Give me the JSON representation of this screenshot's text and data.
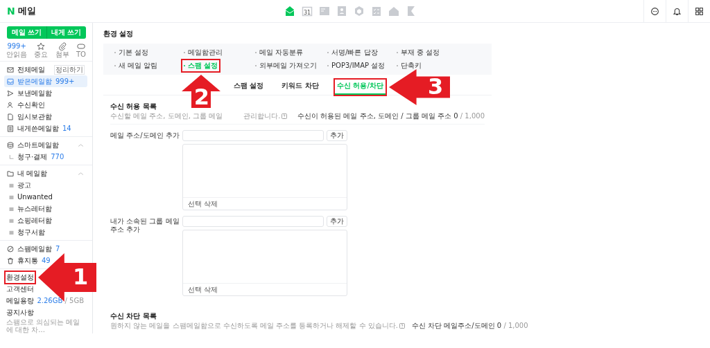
{
  "header": {
    "logo": "N",
    "title": "메일",
    "apps": [
      {
        "kind": "mail",
        "selected": true
      },
      {
        "kind": "calendar",
        "label": "31",
        "selected": false
      },
      {
        "kind": "note",
        "selected": false
      },
      {
        "kind": "contacts",
        "selected": false
      },
      {
        "kind": "cube",
        "selected": false
      },
      {
        "kind": "checklist",
        "selected": false
      },
      {
        "kind": "house",
        "selected": false
      },
      {
        "kind": "bookmark",
        "selected": false
      }
    ],
    "actions": [
      {
        "kind": "chat"
      },
      {
        "kind": "bell"
      },
      {
        "kind": "grid"
      }
    ]
  },
  "sidebar": {
    "compose_buttons": [
      "메일 쓰기",
      "내게 쓰기"
    ],
    "quick_filters": [
      {
        "kind": "count",
        "value": "999+",
        "label": "안읽음"
      },
      {
        "kind": "star",
        "label": "중요"
      },
      {
        "kind": "clip",
        "label": "첨부"
      },
      {
        "kind": "to",
        "label": "TO"
      }
    ],
    "mailboxes": [
      {
        "label": "전체메일",
        "action": "정리하기",
        "selected": false
      },
      {
        "label": "받은메일함",
        "count": "999+",
        "selected": true
      },
      {
        "label": "보낸메일함",
        "selected": false
      },
      {
        "label": "수신확인",
        "selected": false
      },
      {
        "label": "임시보관함",
        "selected": false
      },
      {
        "label": "내게쓴메일함",
        "count": "14",
        "selected": false
      }
    ],
    "groups": [
      {
        "title": "스마트메일함",
        "expanded": true,
        "children": [
          {
            "label": "청구·결제",
            "count": "770"
          }
        ]
      },
      {
        "title": "내 메일함",
        "expanded": true,
        "children": [
          {
            "label": "광고"
          },
          {
            "label": "Unwanted"
          },
          {
            "label": "뉴스레터함"
          },
          {
            "label": "쇼핑레터함"
          },
          {
            "label": "청구서함"
          }
        ]
      }
    ],
    "special": [
      {
        "label": "스팸메일함",
        "count": "7"
      },
      {
        "label": "휴지통",
        "count": "49"
      }
    ],
    "links": [
      {
        "label": "환경설정",
        "highlighted": true
      },
      {
        "label": "고객센터",
        "highlighted": false
      },
      {
        "label": "메일용량",
        "used": "2.26GB",
        "total": "/ 5GB",
        "highlighted": false
      },
      {
        "label": "공지사항",
        "highlighted": false
      }
    ],
    "notice": "스팸으로 의심되는 메일에 대한 차..."
  },
  "main": {
    "title": "환경 설정",
    "menu": [
      {
        "label": "기본 설정",
        "selected": false,
        "highlighted": false
      },
      {
        "label": "메일함관리",
        "selected": false,
        "highlighted": false
      },
      {
        "label": "메일 자동분류",
        "selected": false,
        "highlighted": false
      },
      {
        "label": "서명/빠른 답장",
        "selected": false,
        "highlighted": false
      },
      {
        "label": "부재 중 설정",
        "selected": false,
        "highlighted": false
      },
      {
        "label": "새 메일 알림",
        "selected": false,
        "highlighted": false
      },
      {
        "label": "스팸 설정",
        "selected": true,
        "highlighted": true
      },
      {
        "label": "외부메일 가져오기",
        "selected": false,
        "highlighted": false
      },
      {
        "label": "POP3/IMAP 설정",
        "selected": false,
        "highlighted": false
      },
      {
        "label": "단축키",
        "selected": false,
        "highlighted": false
      }
    ],
    "tabs": [
      {
        "label": "스팸 설정",
        "selected": false,
        "highlighted": false
      },
      {
        "label": "키워드 차단",
        "selected": false,
        "highlighted": false
      },
      {
        "label": "수신 허용/차단",
        "selected": true,
        "highlighted": true
      }
    ],
    "sections": [
      {
        "title": "수신 허용 목록",
        "description": [
          "수신할 메일 주소, 도메인, 그룹 메일",
          "관리합니다."
        ],
        "summary_label": "수신이 허용된 메일 주소, 도메인 / 그룹 메일 주소",
        "summary_count": "0",
        "summary_total": "/ 1,000",
        "rows": [
          {
            "label": "메일 주소/도메인 추가",
            "button": "추가",
            "list_footer": "선택 삭제"
          },
          {
            "label": "내가 소속된 그룹 메일 주소 추가",
            "button": "추가",
            "list_footer": "선택 삭제"
          }
        ]
      },
      {
        "title": "수신 차단 목록",
        "description": [
          "원하지 않는 메일을 스팸메일함으로 수신하도록 메일 주소를 등록하거나 해제할 수 있습니다."
        ],
        "summary_label": "수신 차단 메일주소/도메인",
        "summary_count": "0",
        "summary_total": "/ 1,000"
      }
    ]
  },
  "annotations": [
    {
      "number": "1"
    },
    {
      "number": "2"
    },
    {
      "number": "3"
    }
  ]
}
